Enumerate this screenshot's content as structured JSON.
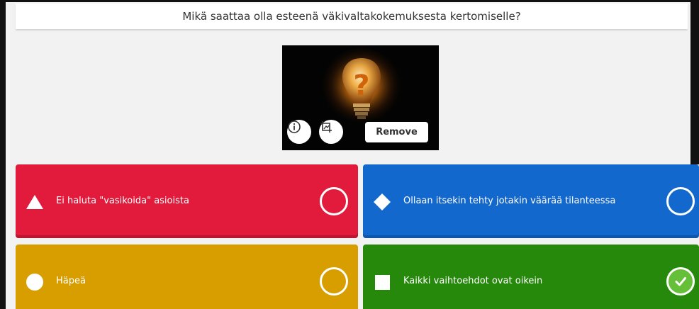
{
  "question": {
    "text": "Mikä saattaa olla esteenä väkivaltakokemuksesta kertomiselle?"
  },
  "media": {
    "image_icon": "lightbulb-question-image",
    "info_icon": "info-icon",
    "crop_icon": "crop-icon",
    "remove_label": "Remove"
  },
  "answers": [
    {
      "text": "Ei haluta \"vasikoida\" asioista",
      "shape": "triangle",
      "color": "#e21b3c",
      "correct": false
    },
    {
      "text": "Ollaan itsekin tehty jotakin väärää tilanteessa",
      "shape": "diamond",
      "color": "#1368ce",
      "correct": false
    },
    {
      "text": "Häpeä",
      "shape": "circle",
      "color": "#d89e00",
      "correct": false
    },
    {
      "text": "Kaikki vaihtoehdot ovat oikein",
      "shape": "square",
      "color": "#26890c",
      "correct": true
    }
  ]
}
